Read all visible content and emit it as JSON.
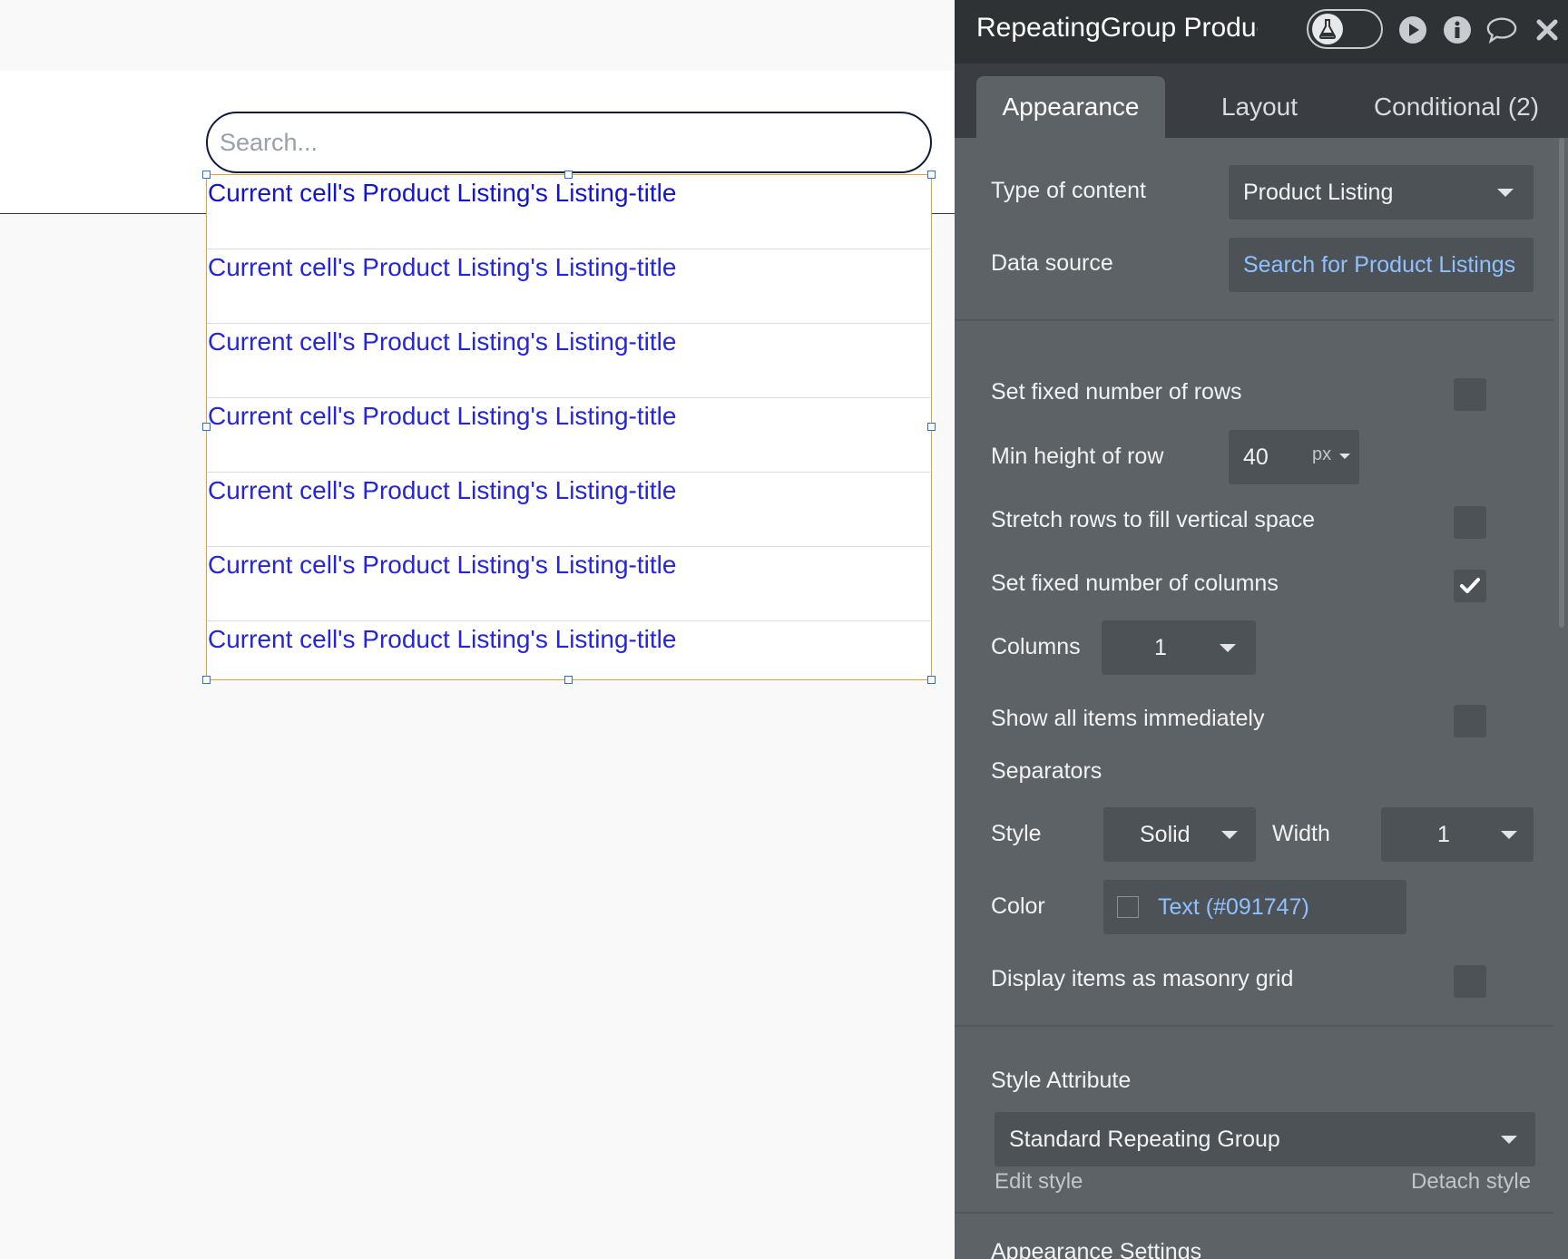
{
  "canvas": {
    "search_placeholder": "Search...",
    "rows": [
      "Current cell's Product Listing's Listing-title",
      "Current cell's Product Listing's Listing-title",
      "Current cell's Product Listing's Listing-title",
      "Current cell's Product Listing's Listing-title",
      "Current cell's Product Listing's Listing-title",
      "Current cell's Product Listing's Listing-title",
      "Current cell's Product Listing's Listing-title"
    ]
  },
  "panel": {
    "title": "RepeatingGroup Product Listings",
    "tabs": {
      "appearance": "Appearance",
      "layout": "Layout",
      "conditional": "Conditional (2)"
    },
    "type_of_content": {
      "label": "Type of content",
      "value": "Product Listing"
    },
    "data_source": {
      "label": "Data source",
      "value": "Search for Product Listings"
    },
    "fixed_rows": {
      "label": "Set fixed number of rows",
      "checked": false
    },
    "min_height": {
      "label": "Min height of row",
      "value": "40",
      "unit": "px"
    },
    "stretch_rows": {
      "label": "Stretch rows to fill vertical space",
      "checked": false
    },
    "fixed_columns": {
      "label": "Set fixed number of columns",
      "checked": true
    },
    "columns": {
      "label": "Columns",
      "value": "1"
    },
    "show_all": {
      "label": "Show all items immediately",
      "checked": false
    },
    "separators": {
      "heading": "Separators",
      "style_label": "Style",
      "style_value": "Solid",
      "width_label": "Width",
      "width_value": "1",
      "color_label": "Color",
      "color_value": "Text (#091747)"
    },
    "masonry": {
      "label": "Display items as masonry grid",
      "checked": false
    },
    "style_attribute": {
      "label": "Style Attribute",
      "value": "Standard Repeating Group",
      "edit": "Edit style",
      "detach": "Detach style"
    },
    "appearance_settings": "Appearance Settings"
  },
  "colors": {
    "panel_bg": "#5d6266",
    "panel_dark": "#2f3235",
    "field_bg": "#4d5256",
    "link": "#8ec1ff",
    "rg_border": "#e3a13a",
    "cell_text": "#2626d8"
  }
}
